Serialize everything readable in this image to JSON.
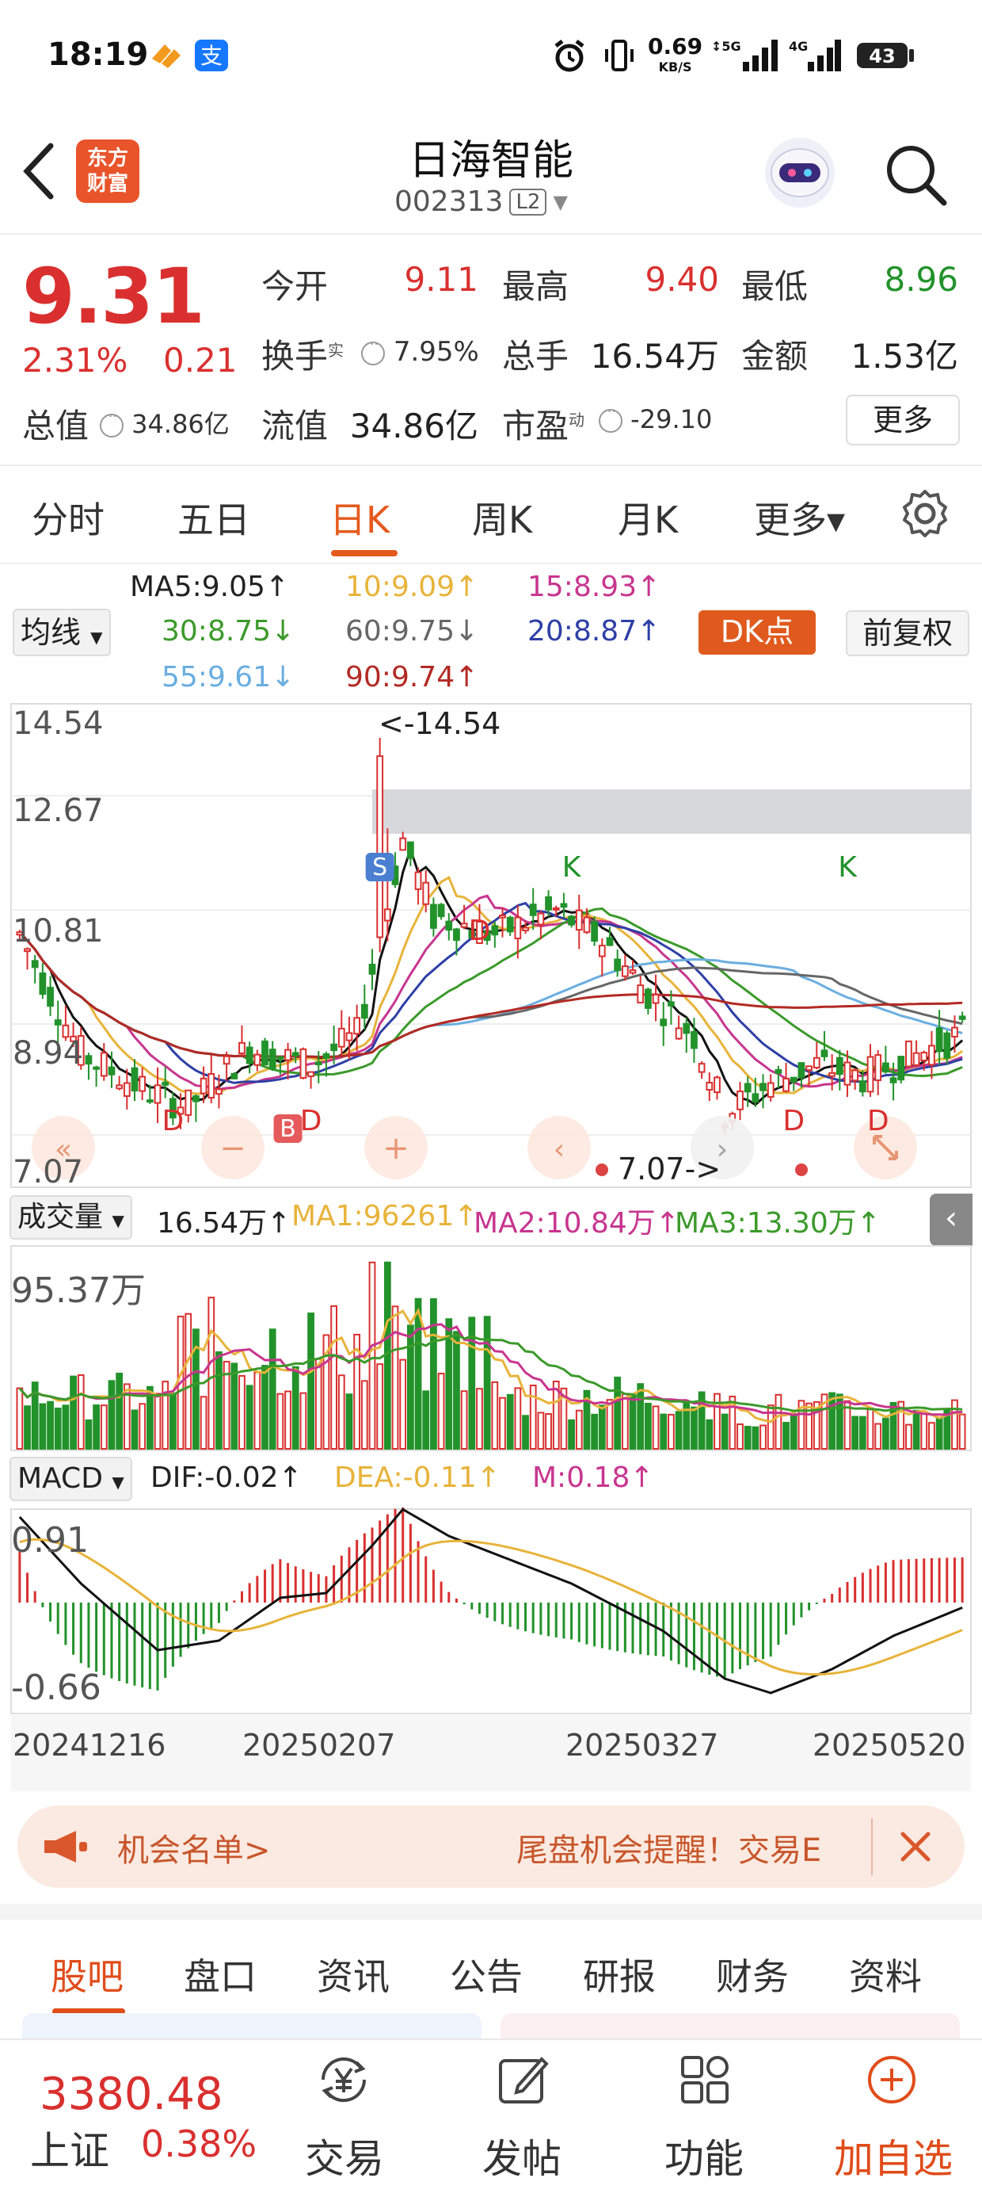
{
  "status_bar": {
    "time": "18:19",
    "net_speed": "0.69",
    "net_unit": "KB/S",
    "sig1": "5G",
    "sig2": "4G",
    "battery": "43"
  },
  "header": {
    "logo_line1": "东方",
    "logo_line2": "财富",
    "stock_name": "日海智能",
    "stock_code": "002313",
    "level": "L2"
  },
  "quote": {
    "price": "9.31",
    "change_pct": "2.31%",
    "change": "0.21",
    "open_label": "今开",
    "open": "9.11",
    "high_label": "最高",
    "high": "9.40",
    "low_label": "最低",
    "low": "8.96",
    "turnover_label": "换手",
    "turnover_sup": "实",
    "turnover": "7.95%",
    "volume_label": "总手",
    "volume": "16.54万",
    "amount_label": "金额",
    "amount": "1.53亿",
    "mktcap_label": "总值",
    "mktcap": "34.86亿",
    "float_label": "流值",
    "float": "34.86亿",
    "pe_label": "市盈",
    "pe_sup": "动",
    "pe": "-29.10",
    "more_label": "更多"
  },
  "tabs": [
    "分时",
    "五日",
    "日K",
    "周K",
    "月K",
    "更多▾"
  ],
  "ma_legend": {
    "selector": "均线",
    "ma5": "MA5:9.05↑",
    "ma10": "10:9.09↑",
    "ma15": "15:8.93↑",
    "ma30": "30:8.75↓",
    "ma60": "60:9.75↓",
    "ma20": "20:8.87↑",
    "ma55": "55:9.61↓",
    "ma90": "90:9.74↑",
    "dk_label": "DK点",
    "fq_label": "前复权"
  },
  "kline": {
    "y_labels": [
      "14.54",
      "12.67",
      "10.81",
      "8.94",
      "7.07"
    ],
    "max_label": "<-14.54",
    "min_label": "7.07->",
    "signals": [
      "S",
      "B",
      "D",
      "D",
      "D",
      "D",
      "K",
      "K"
    ]
  },
  "volume_panel": {
    "selector": "成交量",
    "vol": "16.54万↑",
    "ma1": "MA1:96261↑",
    "ma2": "MA2:10.84万↑",
    "ma3": "MA3:13.30万↑",
    "max_label": "95.37万"
  },
  "macd_panel": {
    "selector": "MACD",
    "dif": "DIF:-0.02↑",
    "dea": "DEA:-0.11↑",
    "m": "M:0.18↑",
    "top_label": "0.91",
    "bottom_label": "-0.66",
    "dates": [
      "20241216",
      "20250207",
      "20250327",
      "20250520"
    ]
  },
  "banner": {
    "left_text": "机会名单>",
    "right_text": "尾盘机会提醒！交易E"
  },
  "bottom_tabs": [
    "股吧",
    "盘口",
    "资讯",
    "公告",
    "研报",
    "财务",
    "资料"
  ],
  "footer": {
    "index_value": "3380.48",
    "index_name": "上证",
    "index_pct": "0.38%",
    "trade": "交易",
    "post": "发帖",
    "func": "功能",
    "add": "加自选"
  },
  "colors": {
    "up": "#d9302f",
    "down": "#22922b",
    "accent": "#e55a1c",
    "ma5": "#111111",
    "ma10": "#e8b33a",
    "ma15": "#c8358f",
    "ma20": "#2d3fa6",
    "ma30": "#3b9a2a",
    "ma55": "#6aaee0",
    "ma60": "#666666",
    "ma90": "#b32a24"
  }
}
